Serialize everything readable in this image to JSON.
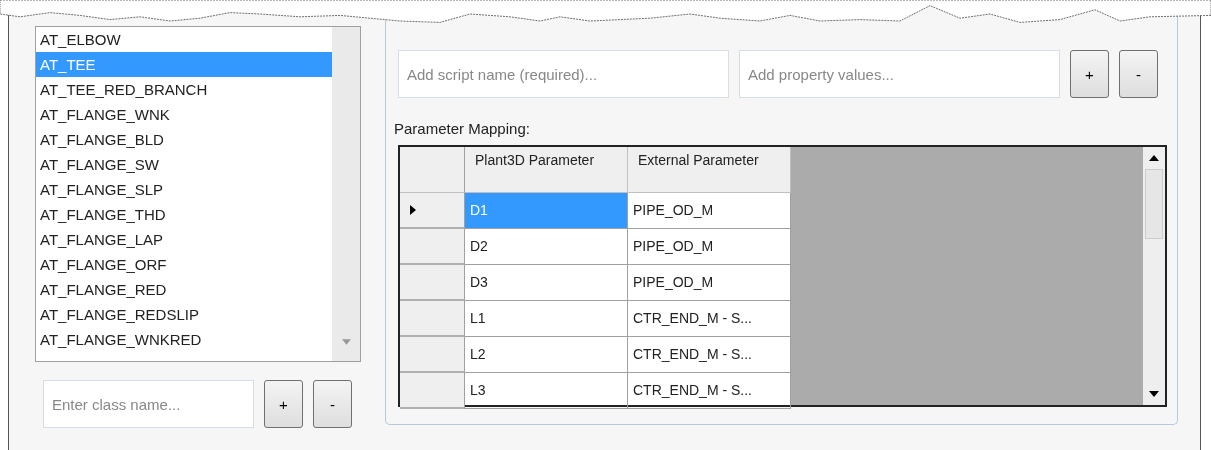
{
  "class_list": {
    "items": [
      {
        "label": "AT_ELBOW",
        "selected": false
      },
      {
        "label": "AT_TEE",
        "selected": true
      },
      {
        "label": "AT_TEE_RED_BRANCH",
        "selected": false
      },
      {
        "label": "AT_FLANGE_WNK",
        "selected": false
      },
      {
        "label": "AT_FLANGE_BLD",
        "selected": false
      },
      {
        "label": "AT_FLANGE_SW",
        "selected": false
      },
      {
        "label": "AT_FLANGE_SLP",
        "selected": false
      },
      {
        "label": "AT_FLANGE_THD",
        "selected": false
      },
      {
        "label": "AT_FLANGE_LAP",
        "selected": false
      },
      {
        "label": "AT_FLANGE_ORF",
        "selected": false
      },
      {
        "label": "AT_FLANGE_RED",
        "selected": false
      },
      {
        "label": "AT_FLANGE_REDSLIP",
        "selected": false
      },
      {
        "label": "AT_FLANGE_WNKRED",
        "selected": false
      }
    ],
    "class_field": {
      "placeholder": "Enter class name..."
    },
    "buttons": [
      "+",
      "-"
    ]
  },
  "script_panel": {
    "script_field": {
      "placeholder": "Add script name (required)..."
    },
    "property_field": {
      "placeholder": "Add property values..."
    },
    "buttons": [
      "+",
      "-"
    ],
    "mapping_label": "Parameter Mapping:",
    "table": {
      "columns": [
        "Plant3D Parameter",
        "External Parameter"
      ],
      "rows": [
        {
          "cells": [
            "D1",
            "PIPE_OD_M"
          ],
          "selected": true
        },
        {
          "cells": [
            "D2",
            "PIPE_OD_M"
          ],
          "selected": false
        },
        {
          "cells": [
            "D3",
            "PIPE_OD_M"
          ],
          "selected": false
        },
        {
          "cells": [
            "L1",
            "CTR_END_M - S..."
          ],
          "selected": false
        },
        {
          "cells": [
            "L2",
            "CTR_END_M - S..."
          ],
          "selected": false
        },
        {
          "cells": [
            "L3",
            "CTR_END_M - S..."
          ],
          "selected": false
        }
      ]
    }
  }
}
